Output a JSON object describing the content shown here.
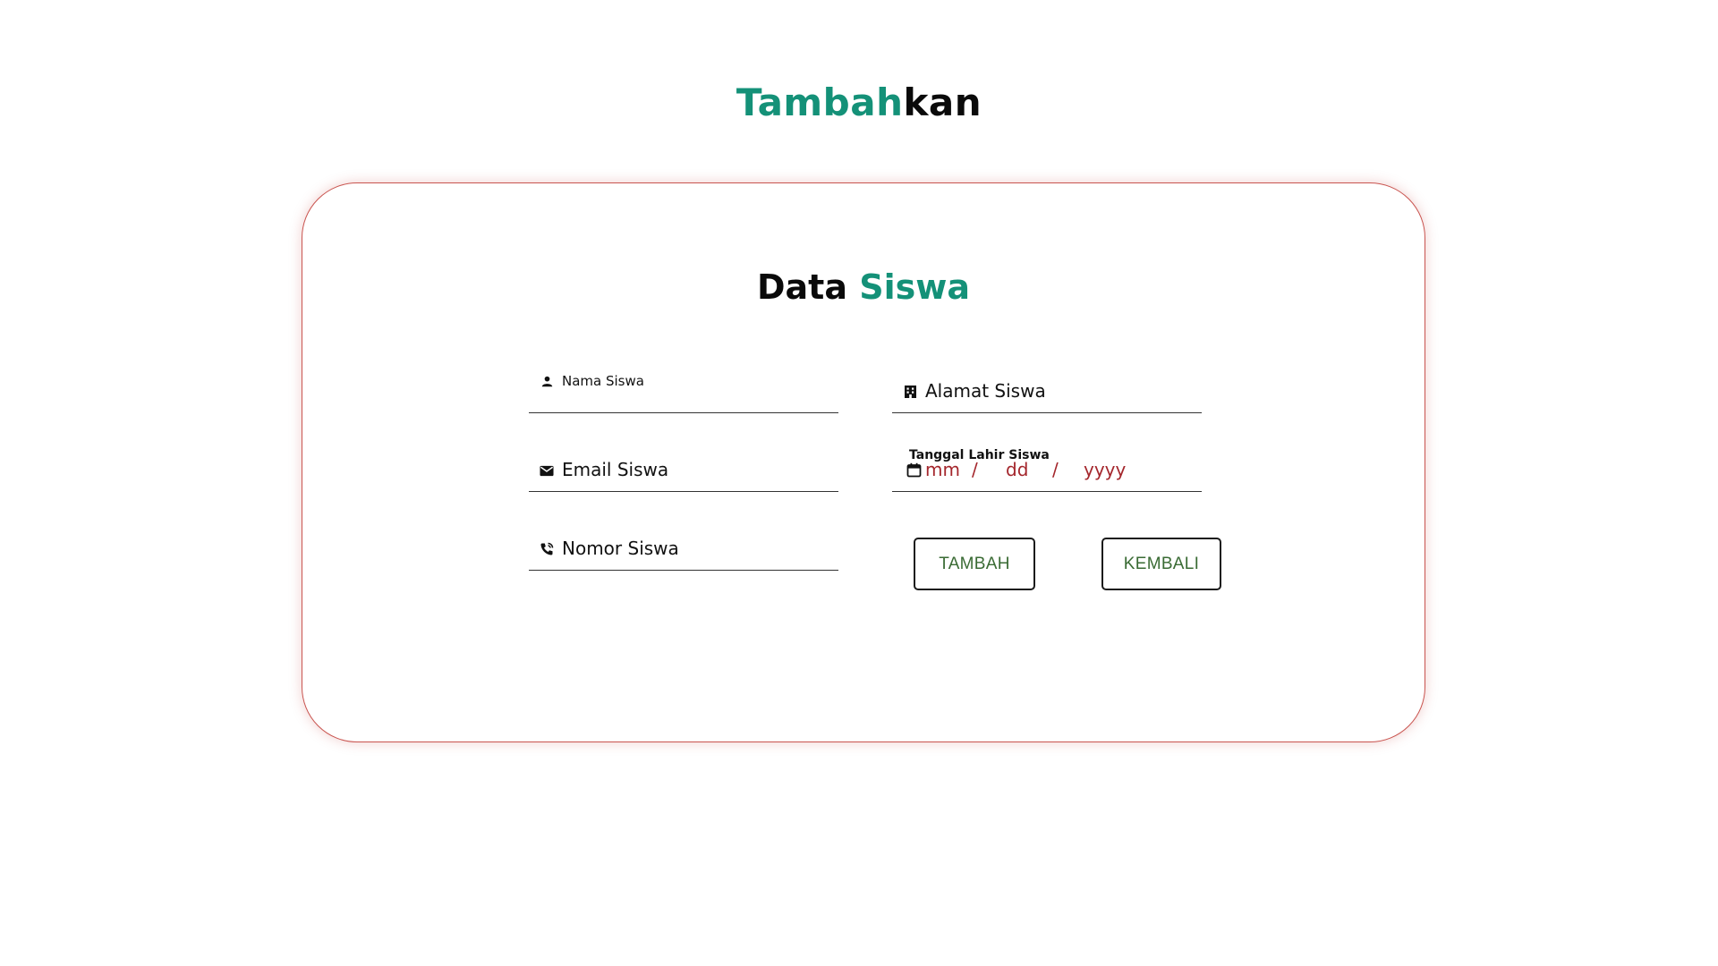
{
  "page": {
    "heading_accent": "Tambah",
    "heading_dark": "kan"
  },
  "form": {
    "title_dark": "Data",
    "title_accent": "Siswa",
    "fields": {
      "nama": {
        "label": "Nama Siswa",
        "icon": "person-icon"
      },
      "alamat": {
        "label": "Alamat Siswa",
        "icon": "building-icon"
      },
      "email": {
        "label": "Email Siswa",
        "icon": "envelope-icon"
      },
      "tanggal": {
        "label": "Tanggal Lahir Siswa",
        "icon": "calendar-icon",
        "month_placeholder": "mm",
        "day_placeholder": "dd",
        "year_placeholder": "yyyy",
        "separator": "/"
      },
      "nomor": {
        "label": "Nomor Siswa",
        "icon": "phone-icon"
      }
    },
    "buttons": {
      "tambah": "TAMBAH",
      "kembali": "KEMBALI"
    }
  },
  "colors": {
    "accent": "#149178",
    "card_border": "#c9544f",
    "date_placeholder": "#a4262c",
    "button_text": "#3a6b34"
  }
}
